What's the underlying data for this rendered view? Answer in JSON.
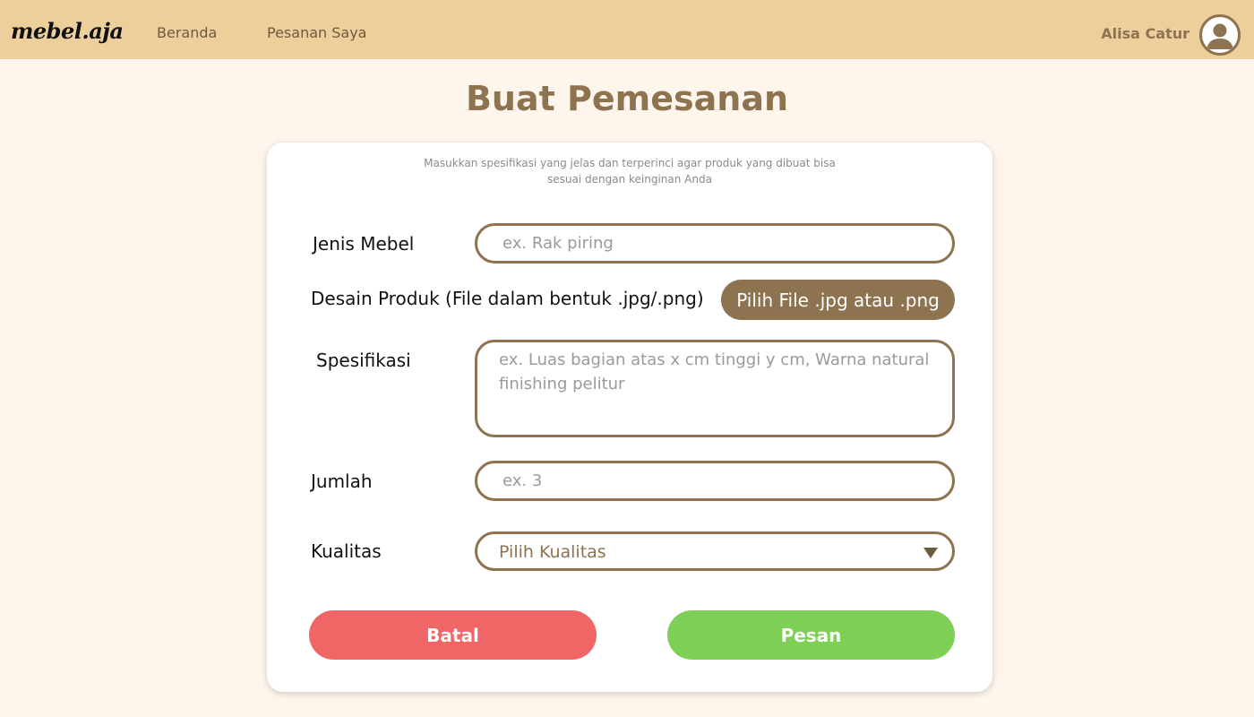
{
  "brand": {
    "logo_text": "mebel.aja"
  },
  "nav": {
    "items": [
      {
        "label": "Beranda"
      },
      {
        "label": "Pesanan Saya"
      }
    ]
  },
  "user": {
    "name": "Alisa Catur",
    "avatar_icon": "user-circle-icon"
  },
  "page": {
    "title": "Buat Pemesanan"
  },
  "form": {
    "hint": "Masukkan spesifikasi yang jelas dan terperinci agar produk yang dibuat bisa sesuai dengan keinginan Anda",
    "furniture_type": {
      "label": "Jenis Mebel",
      "placeholder": "ex. Rak piring",
      "value": ""
    },
    "design": {
      "label": "Desain Produk (File dalam bentuk .jpg/.png)",
      "button_label": "Pilih File .jpg atau .png"
    },
    "specification": {
      "label": "Spesifikasi",
      "placeholder": "ex. Luas bagian atas x cm tinggi y cm, Warna natural finishing pelitur",
      "value": ""
    },
    "quantity": {
      "label": "Jumlah",
      "placeholder": "ex. 3",
      "value": ""
    },
    "quality": {
      "label": "Kualitas",
      "selected": "Pilih Kualitas",
      "icon": "chevron-down-icon"
    },
    "cancel_label": "Batal",
    "submit_label": "Pesan"
  },
  "colors": {
    "navbar": "#edcf9c",
    "background": "#fef6ec",
    "accent": "#8e7350",
    "cancel": "#f06666",
    "submit": "#7dcf55"
  }
}
